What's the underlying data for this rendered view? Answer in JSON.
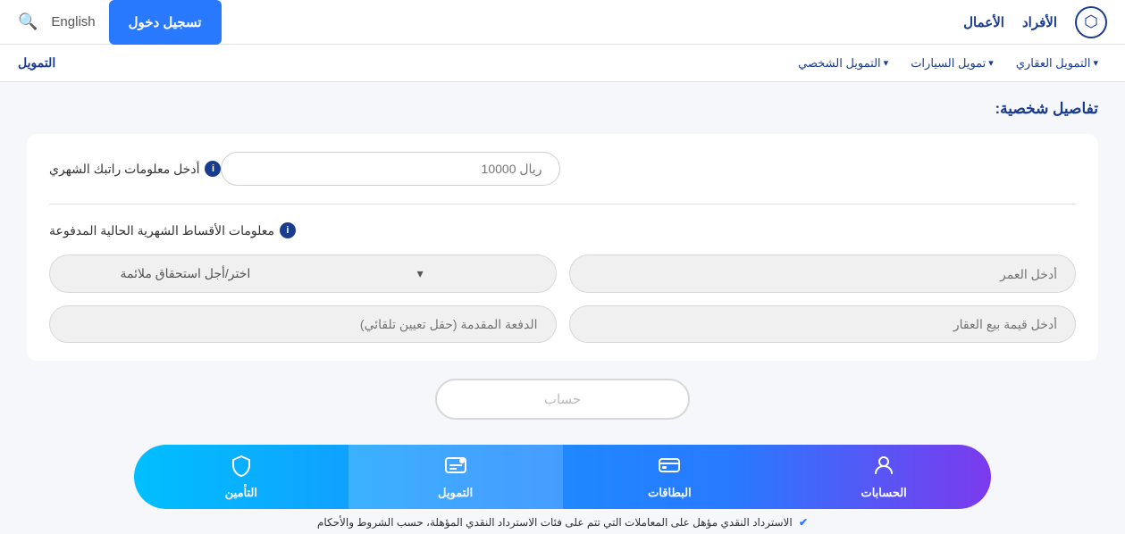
{
  "topNav": {
    "logo": "⬡",
    "links": [
      {
        "label": "الأفراد",
        "id": "individuals"
      },
      {
        "label": "الأعمال",
        "id": "business"
      }
    ],
    "english_label": "English",
    "search_label": "🔍",
    "login_label": "تسجيل دخول"
  },
  "secondNav": {
    "title": "التمويل",
    "items": [
      {
        "label": "التمويل العقاري",
        "id": "real-estate"
      },
      {
        "label": "تمويل السيارات",
        "id": "cars"
      },
      {
        "label": "التمويل الشخصي",
        "id": "personal"
      }
    ]
  },
  "page": {
    "section_title": "تفاصيل شخصية:",
    "salary_label": "أدخل معلومات راتبك الشهري",
    "salary_placeholder": "ريال 10000",
    "installment_label": "معلومات الأقساط الشهرية الحالية المدفوعة",
    "age_placeholder": "أدخل العمر",
    "eligibility_label": "اختر/أجل استحقاق ملائمة",
    "property_value_placeholder": "أدخل قيمة بيع العقار",
    "down_payment_placeholder": "الدفعة المقدمة (حقل تعيين تلقائي)",
    "calc_button": "حساب",
    "info_icon": "i"
  },
  "tabs": [
    {
      "label": "الحسابات",
      "icon": "👤",
      "id": "accounts"
    },
    {
      "label": "البطاقات",
      "icon": "💳",
      "id": "cards"
    },
    {
      "label": "التمويل",
      "icon": "💰",
      "id": "financing",
      "active": true
    },
    {
      "label": "التأمين",
      "icon": "🛡",
      "id": "insurance"
    }
  ],
  "bottom_note": "الاسترداد النقدي مؤهل على المعاملات التي تتم على فئات الاسترداد النقدي المؤهلة، حسب الشروط والأحكام"
}
